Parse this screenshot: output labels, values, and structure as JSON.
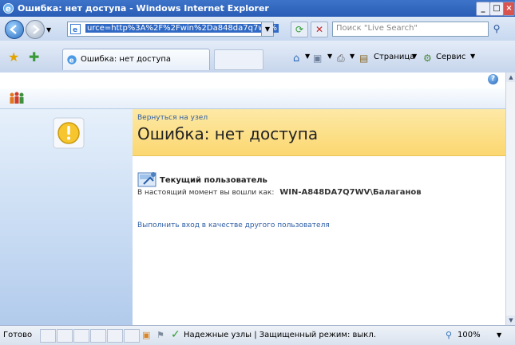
{
  "window": {
    "title": "Ошибка: нет доступа - Windows Internet Explorer",
    "minimize_label": "_",
    "maximize_label": "□",
    "close_label": "×"
  },
  "addressbar": {
    "url": "urce=http%3A%2F%2Fwin%2Da848da7q7wv%",
    "search_placeholder": "Поиск \"Live Search\""
  },
  "tabs": [
    {
      "label": "Ошибка: нет доступа"
    }
  ],
  "commandbar": {
    "page_label": "Страница",
    "tools_label": "Сервис"
  },
  "page": {
    "back_link": "Вернуться на узел",
    "title": "Ошибка: нет доступа",
    "current_user_heading": "Текущий пользователь",
    "logged_in_as_label": "В настоящий момент вы вошли как:",
    "user_name": "WIN-A848DA7Q7WV\\Балаганов",
    "sign_in_other_link": "Выполнить вход в качестве другого пользователя"
  },
  "statusbar": {
    "ready": "Готово",
    "zone": "Надежные узлы | Защищенный режим: выкл.",
    "zoom": "100%"
  }
}
